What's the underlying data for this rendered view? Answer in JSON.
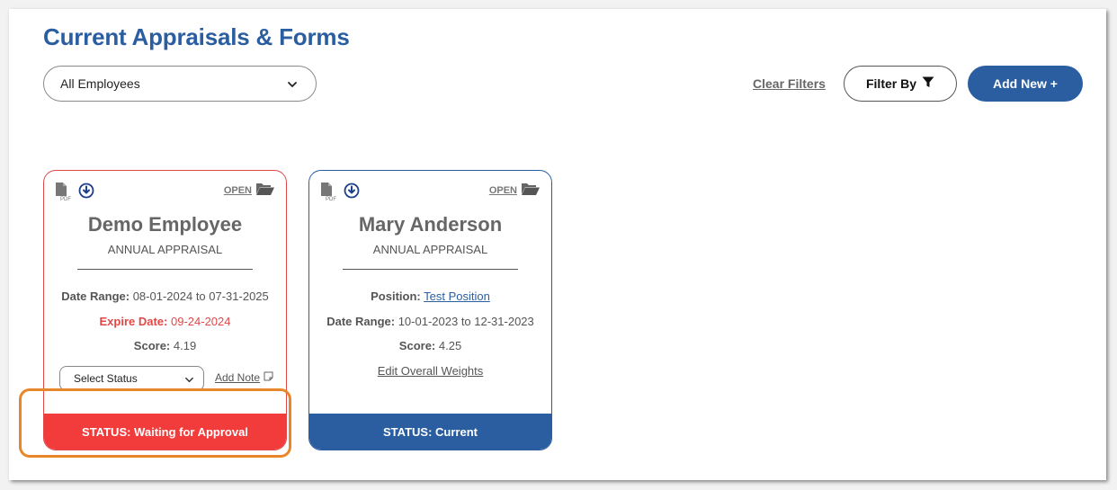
{
  "header": {
    "title": "Current Appraisals & Forms"
  },
  "toolbar": {
    "employee_select_value": "All Employees",
    "clear_filters_label": "Clear Filters",
    "filter_by_label": "Filter By",
    "add_new_label": "Add New +"
  },
  "cards": [
    {
      "open_label": "OPEN",
      "name": "Demo Employee",
      "type": "ANNUAL APPRAISAL",
      "date_range_label": "Date Range:",
      "date_range_value": "08-01-2024 to 07-31-2025",
      "expire_label": "Expire Date:",
      "expire_value": "09-24-2024",
      "score_label": "Score:",
      "score_value": "4.19",
      "status_select_placeholder": "Select Status",
      "add_note_label": "Add Note",
      "status": "STATUS: Waiting for Approval"
    },
    {
      "open_label": "OPEN",
      "name": "Mary Anderson",
      "type": "ANNUAL APPRAISAL",
      "position_label": "Position:",
      "position_value": "Test Position",
      "date_range_label": "Date Range:",
      "date_range_value": "10-01-2023 to 12-31-2023",
      "score_label": "Score:",
      "score_value": "4.25",
      "edit_weights_label": "Edit Overall Weights",
      "status": "STATUS: Current"
    }
  ],
  "colors": {
    "brand_blue": "#2a5ea0",
    "status_waiting": "#f23c3c",
    "expire_red": "#e04848",
    "highlight_orange": "#e8862a"
  },
  "icons": [
    "pdf-file-icon",
    "download-circle-icon",
    "folder-open-icon",
    "chevron-down-icon",
    "filter-funnel-icon",
    "note-icon"
  ]
}
